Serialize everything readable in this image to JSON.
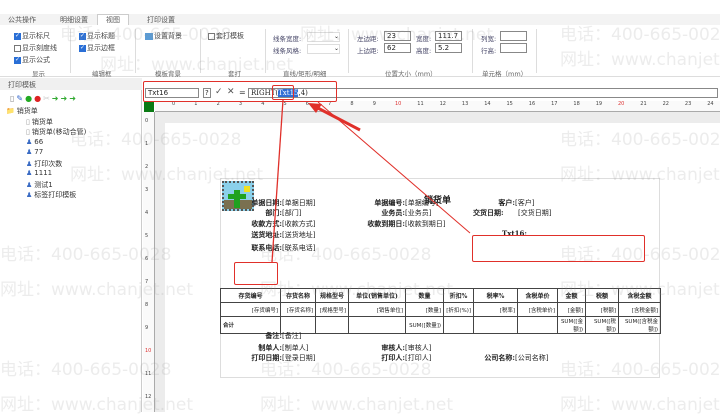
{
  "ribbon": {
    "tabs": [
      "公共操作",
      "明细设置",
      "视图",
      "打印设置"
    ],
    "active_tab": "视图",
    "display": {
      "show_ruler": "显示标尺",
      "show_grid": "显示刻度线",
      "show_formula": "显示公式",
      "label": "显示"
    },
    "edit": {
      "show_title": "显示标题",
      "show_border": "显示边框",
      "label": "编辑框"
    },
    "background": {
      "set_bg": "设置背景",
      "label": "模板背景"
    },
    "overprint": {
      "overprint_template": "套打模板",
      "label": "套打"
    },
    "lines": {
      "line_width": "线条宽度:",
      "line_style": "线条风格:",
      "label": "直线/矩形/明细"
    },
    "position": {
      "left_label": "左边距:",
      "left": "23",
      "top_label": "上边距:",
      "top": "62",
      "width_label": "宽度:",
      "width": "111.7",
      "height_label": "高度:",
      "height": "5.2",
      "label": "位置大小（mm）"
    },
    "cell": {
      "col_width": "列宽:",
      "row_height": "行高:",
      "label": "单元格（mm）",
      "col_width_value": "",
      "row_height_value": ""
    }
  },
  "left_panel": {
    "title": "打印模板",
    "tree": [
      {
        "label": "销货单",
        "type": "folder"
      },
      {
        "label": "销货单",
        "type": "doc"
      },
      {
        "label": "销货单(移动合管)",
        "type": "doc"
      },
      {
        "label": "66",
        "type": "user"
      },
      {
        "label": "77",
        "type": "user"
      },
      {
        "label": "打印次数",
        "type": "user"
      },
      {
        "label": "1111",
        "type": "user"
      },
      {
        "label": "测试1",
        "type": "user"
      },
      {
        "label": "标签打印模板",
        "type": "user"
      }
    ]
  },
  "formula": {
    "name": "Txt16",
    "equals": "=",
    "prefix": "RIGHT(",
    "highlight": "Txt15",
    "suffix": ",4)"
  },
  "ruler": {
    "h": [
      "0",
      "1",
      "2",
      "3",
      "4",
      "5",
      "6",
      "7",
      "8",
      "9",
      "10",
      "11",
      "12",
      "13",
      "14",
      "15",
      "16",
      "17",
      "18",
      "19",
      "20",
      "21",
      "22",
      "23",
      "24"
    ],
    "v": [
      "0",
      "1",
      "2",
      "3",
      "4",
      "5",
      "6",
      "7",
      "8",
      "9",
      "10",
      "11",
      "12"
    ]
  },
  "report": {
    "title": "销货单",
    "fields": [
      {
        "label": "单据日期:",
        "value": "[单据日期]"
      },
      {
        "label": "单据编号:",
        "value": "[单据编号]"
      },
      {
        "label": "客户:",
        "value": "[客户]"
      },
      {
        "label": "部门:",
        "value": "[部门]"
      },
      {
        "label": "业务员:",
        "value": "[业务员]"
      },
      {
        "label": "交货日期:",
        "value": "[交货日期]"
      },
      {
        "label": "收款方式:",
        "value": "[收款方式]"
      },
      {
        "label": "收款到期日:",
        "value": "[收款到期日]"
      },
      {
        "label": "Txt16:",
        "value": ""
      },
      {
        "label": "送货地址:",
        "value": "[送货地址]"
      },
      {
        "label": "联系电话:",
        "value": "[联系电话]"
      }
    ],
    "columns": [
      "存货编号",
      "存货名称",
      "规格型号",
      "单位(销售单位)",
      "数量",
      "折扣%",
      "税率%",
      "含税单价",
      "金额",
      "税额",
      "含税金额"
    ],
    "data_row": [
      "[存货编号]",
      "[存货名称]",
      "[规格型号]",
      "[销售单位]",
      "[数量]",
      "[折扣(%)]",
      "[税率]",
      "[含税单价]",
      "[金额]",
      "[税额]",
      "[含税金额]"
    ],
    "total_row": [
      "合计",
      "",
      "",
      "",
      "SUM([数量])",
      "",
      "",
      "",
      "SUM([金额])",
      "SUM([税额])",
      "SUM([含税金额])"
    ],
    "footer": [
      {
        "label": "备注:",
        "value": "[备注]"
      },
      {
        "label": "制单人:",
        "value": "[制单人]"
      },
      {
        "label": "审核人:",
        "value": "[审核人]"
      },
      {
        "label": "打印日期:",
        "value": "[登录日期]"
      },
      {
        "label": "打印人:",
        "value": "[打印人]"
      },
      {
        "label": "公司名称:",
        "value": "[公司名称]"
      }
    ]
  },
  "watermark": {
    "phone": "电话：400-665-0028",
    "site": "网址：www.chanjet.net"
  },
  "colors": {
    "annotation": "#e0302a",
    "checkbox": "#2a6fd6",
    "ruler_block": "#0a7a14"
  }
}
